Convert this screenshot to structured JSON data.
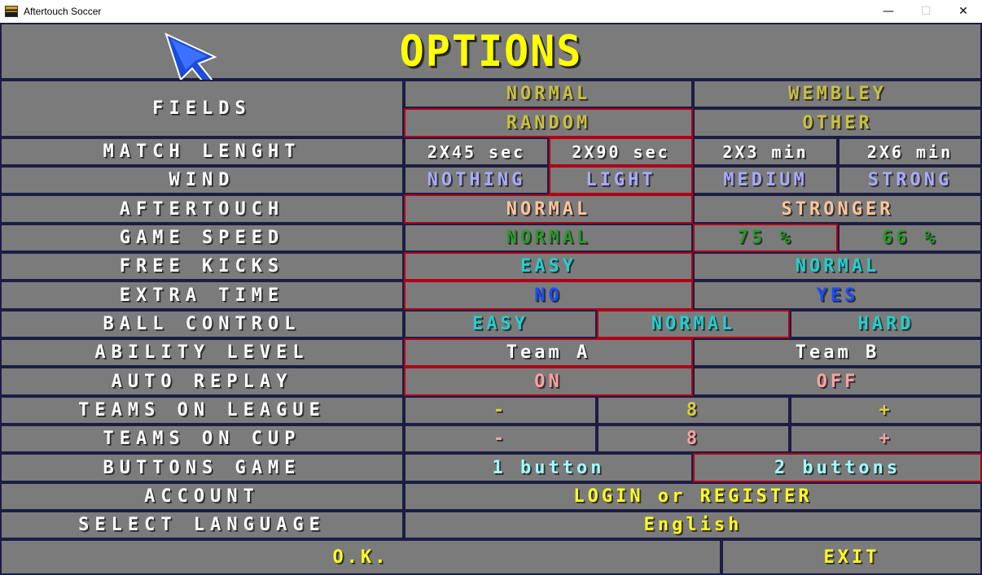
{
  "window": {
    "title": "Aftertouch Soccer",
    "minimize": "—",
    "maximize": "☐",
    "close": "✕"
  },
  "header": {
    "title": "OPTIONS"
  },
  "rows": {
    "fields": {
      "label": "FIELDS",
      "normal": "NORMAL",
      "wembley": "WEMBLEY",
      "random": "RANDOM",
      "other": "OTHER"
    },
    "match_length": {
      "label": "MATCH LENGHT",
      "o1": "2X45 sec",
      "o2": "2X90 sec",
      "o3": "2X3 min",
      "o4": "2X6 min"
    },
    "wind": {
      "label": "WIND",
      "o1": "NOTHING",
      "o2": "LIGHT",
      "o3": "MEDIUM",
      "o4": "STRONG"
    },
    "aftertouch": {
      "label": "AFTERTOUCH",
      "o1": "NORMAL",
      "o2": "STRONGER"
    },
    "game_speed": {
      "label": "GAME SPEED",
      "o1": "NORMAL",
      "o2": "75 %",
      "o3": "66 %"
    },
    "free_kicks": {
      "label": "FREE KICKS",
      "o1": "EASY",
      "o2": "NORMAL"
    },
    "extra_time": {
      "label": "EXTRA TIME",
      "o1": "NO",
      "o2": "YES"
    },
    "ball_control": {
      "label": "BALL CONTROL",
      "o1": "EASY",
      "o2": "NORMAL",
      "o3": "HARD"
    },
    "ability_level": {
      "label": "ABILITY LEVEL",
      "o1": "Team A",
      "o2": "Team B"
    },
    "auto_replay": {
      "label": "AUTO REPLAY",
      "o1": "ON",
      "o2": "OFF"
    },
    "teams_league": {
      "label": "TEAMS ON LEAGUE",
      "minus": "-",
      "value": "8",
      "plus": "+"
    },
    "teams_cup": {
      "label": "TEAMS ON CUP",
      "minus": "-",
      "value": "8",
      "plus": "+"
    },
    "buttons_game": {
      "label": "BUTTONS GAME",
      "o1": "1 button",
      "o2": "2 buttons"
    },
    "account": {
      "label": "ACCOUNT",
      "o1": "LOGIN or REGISTER"
    },
    "language": {
      "label": "SELECT LANGUAGE",
      "o1": "English"
    }
  },
  "footer": {
    "ok": "O.K.",
    "exit": "EXIT"
  },
  "colors": {
    "background": "#7b7b7b",
    "border": "#1c1c44",
    "selected_border": "#b00018",
    "title_yellow": "#ffff00"
  },
  "icons": {
    "pointer": "arrow-cursor-icon",
    "app": "app-icon"
  }
}
